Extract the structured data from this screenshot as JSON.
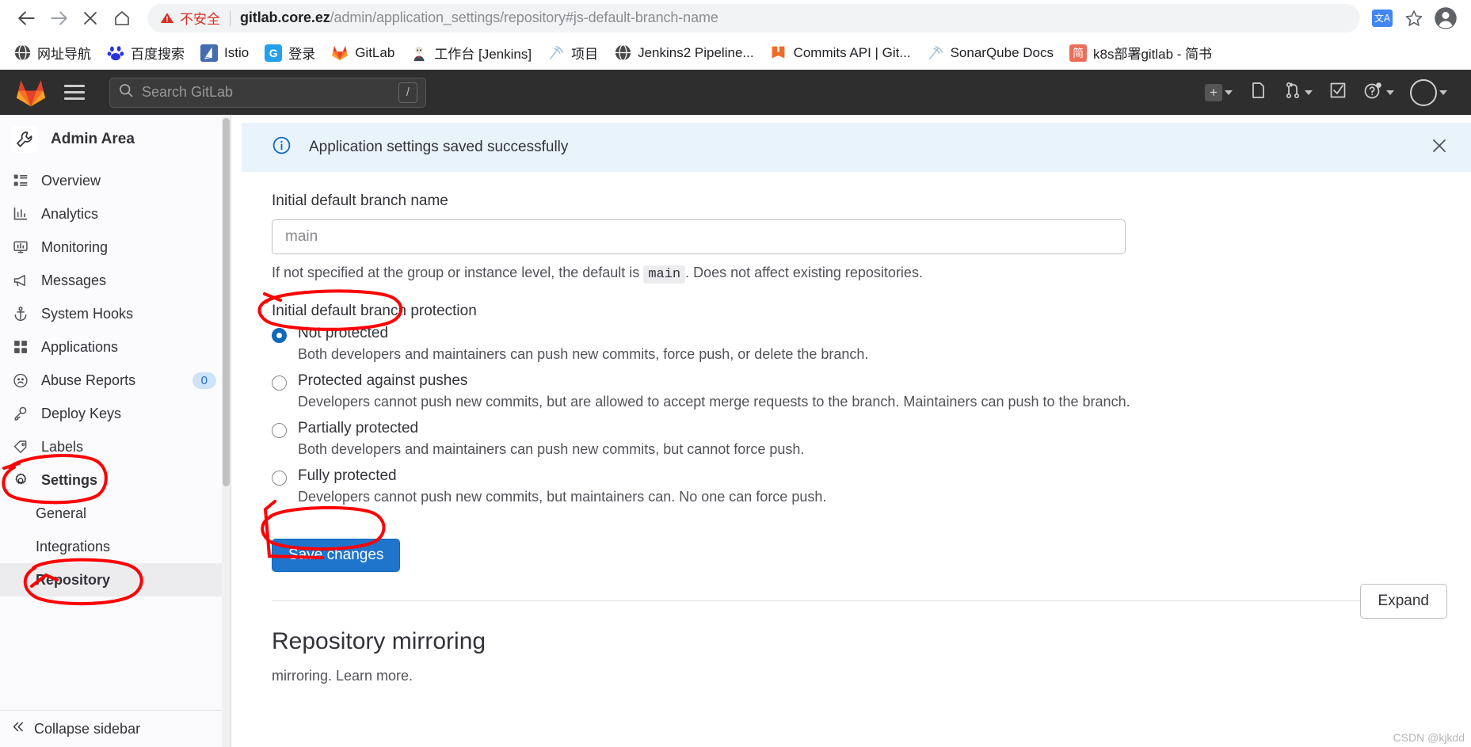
{
  "browser": {
    "nav": {
      "back_icon": "arrow-left-icon",
      "forward_icon": "arrow-right-icon",
      "stop_icon": "close-icon",
      "home_icon": "home-icon"
    },
    "omnibox": {
      "security_label": "不安全",
      "security_icon": "warning-triangle-icon",
      "url_host": "gitlab.core.ez",
      "url_path": "/admin/application_settings/repository#js-default-branch-name",
      "translate_icon": "translate-icon",
      "bookmark_icon": "star-icon",
      "profile_icon": "profile-avatar-icon"
    },
    "bookmarks": [
      {
        "label": "网址导航",
        "icon": "globe-icon"
      },
      {
        "label": "百度搜索",
        "icon": "baidu-paw-icon"
      },
      {
        "label": "Istio",
        "icon": "istio-sail-icon"
      },
      {
        "label": "登录",
        "icon": "g-square-icon"
      },
      {
        "label": "GitLab",
        "icon": "gitlab-fox-icon"
      },
      {
        "label": "工作台 [Jenkins]",
        "icon": "jenkins-butler-icon"
      },
      {
        "label": "项目",
        "icon": "signal-icon"
      },
      {
        "label": "Jenkins2 Pipeline...",
        "icon": "globe-icon"
      },
      {
        "label": "Commits API | Git...",
        "icon": "orange-book-icon"
      },
      {
        "label": "SonarQube Docs",
        "icon": "signal-icon"
      },
      {
        "label": "k8s部署gitlab - 简书",
        "icon": "jianshu-icon"
      }
    ]
  },
  "gitlab_navbar": {
    "logo_icon": "gitlab-fox-icon",
    "menu_icon": "hamburger-icon",
    "search": {
      "placeholder": "Search GitLab",
      "icon": "search-icon",
      "shortcut": "/"
    },
    "right_items": [
      {
        "name": "create-new-menu",
        "icon": "plus-square-icon",
        "has_caret": true
      },
      {
        "name": "issues-link",
        "icon": "issues-icon",
        "has_caret": false
      },
      {
        "name": "merge-requests-menu",
        "icon": "merge-request-icon",
        "has_caret": true
      },
      {
        "name": "todos-link",
        "icon": "todo-checkbox-icon",
        "has_caret": false
      },
      {
        "name": "help-menu",
        "icon": "question-circle-icon",
        "has_caret": true
      },
      {
        "name": "user-menu",
        "icon": "user-avatar-icon",
        "has_caret": true
      }
    ]
  },
  "sidebar": {
    "header": {
      "title": "Admin Area",
      "icon": "wrench-icon"
    },
    "items": [
      {
        "label": "Overview",
        "icon": "list-icon",
        "badge": null,
        "active": false
      },
      {
        "label": "Analytics",
        "icon": "chart-icon",
        "badge": null,
        "active": false
      },
      {
        "label": "Monitoring",
        "icon": "monitor-icon",
        "badge": null,
        "active": false
      },
      {
        "label": "Messages",
        "icon": "megaphone-icon",
        "badge": null,
        "active": false
      },
      {
        "label": "System Hooks",
        "icon": "anchor-icon",
        "badge": null,
        "active": false
      },
      {
        "label": "Applications",
        "icon": "grid-icon",
        "badge": null,
        "active": false
      },
      {
        "label": "Abuse Reports",
        "icon": "sad-face-icon",
        "badge": "0",
        "active": false
      },
      {
        "label": "Deploy Keys",
        "icon": "key-icon",
        "badge": null,
        "active": false
      },
      {
        "label": "Labels",
        "icon": "tag-icon",
        "badge": null,
        "active": false
      },
      {
        "label": "Settings",
        "icon": "gear-icon",
        "badge": null,
        "active": false
      }
    ],
    "sub_items": [
      {
        "label": "General",
        "active": false
      },
      {
        "label": "Integrations",
        "active": false
      },
      {
        "label": "Repository",
        "active": true
      }
    ],
    "collapse": {
      "label": "Collapse sidebar",
      "icon": "chevron-double-left-icon"
    }
  },
  "main": {
    "alert": {
      "message": "Application settings saved successfully",
      "icon": "info-circle-icon",
      "close_icon": "close-icon"
    },
    "branch_name": {
      "label": "Initial default branch name",
      "placeholder": "main",
      "value": "",
      "help_prefix": "If not specified at the group or instance level, the default is",
      "help_code": "main",
      "help_suffix": ". Does not affect existing repositories."
    },
    "branch_protection": {
      "label": "Initial default branch protection",
      "selected_index": 0,
      "options": [
        {
          "label": "Not protected",
          "desc": "Both developers and maintainers can push new commits, force push, or delete the branch."
        },
        {
          "label": "Protected against pushes",
          "desc": "Developers cannot push new commits, but are allowed to accept merge requests to the branch. Maintainers can push to the branch."
        },
        {
          "label": "Partially protected",
          "desc": "Both developers and maintainers can push new commits, but cannot force push."
        },
        {
          "label": "Fully protected",
          "desc": "Developers cannot push new commits, but maintainers can. No one can force push."
        }
      ]
    },
    "save_button": "Save changes",
    "mirroring": {
      "title": "Repository mirroring",
      "help_text": "mirroring. Learn more.",
      "expand_button": "Expand"
    }
  },
  "watermark": "CSDN @kjkdd",
  "colors": {
    "gitlab_dark": "#2e2e2e",
    "accent_blue": "#1f75cb",
    "alert_bg": "#e9f3fc",
    "annotation_red": "#ff0000",
    "warning_red": "#d93025"
  }
}
